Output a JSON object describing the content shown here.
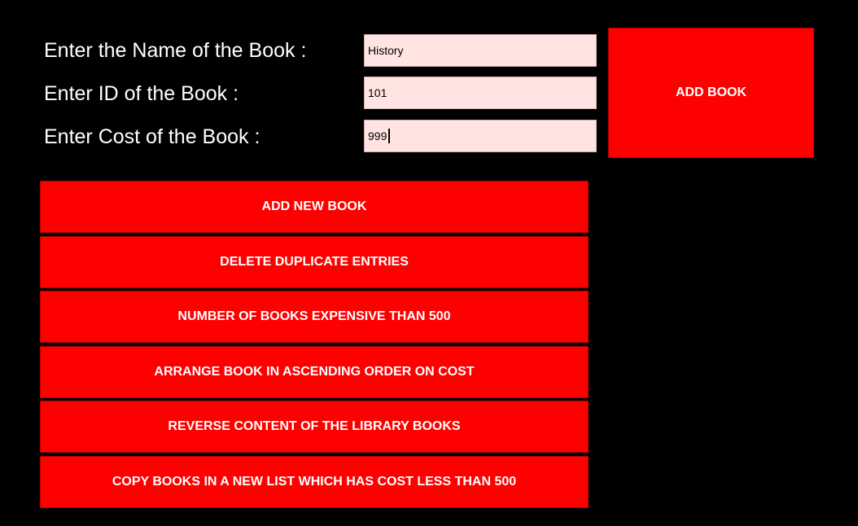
{
  "form": {
    "name_label": "Enter the Name of the Book :",
    "id_label": "Enter ID of the Book :",
    "cost_label": "Enter Cost of the Book :",
    "name_value": "History",
    "id_value": "101",
    "cost_value": "999"
  },
  "add_book_button": "ADD BOOK",
  "menu": {
    "add_new_book": "ADD NEW BOOK",
    "delete_duplicates": "DELETE DUPLICATE ENTRIES",
    "count_expensive": "NUMBER OF BOOKS EXPENSIVE THAN 500",
    "sort_ascending": "ARRANGE BOOK IN ASCENDING ORDER ON COST",
    "reverse_content": "REVERSE CONTENT OF THE LIBRARY BOOKS",
    "copy_cheap": "COPY BOOKS IN A NEW LIST WHICH HAS COST LESS THAN 500"
  },
  "colors": {
    "background": "#000000",
    "button": "#ff0000",
    "button_text": "#ffffff",
    "field_background": "#ffe4e1",
    "label_text": "#ffffff"
  }
}
